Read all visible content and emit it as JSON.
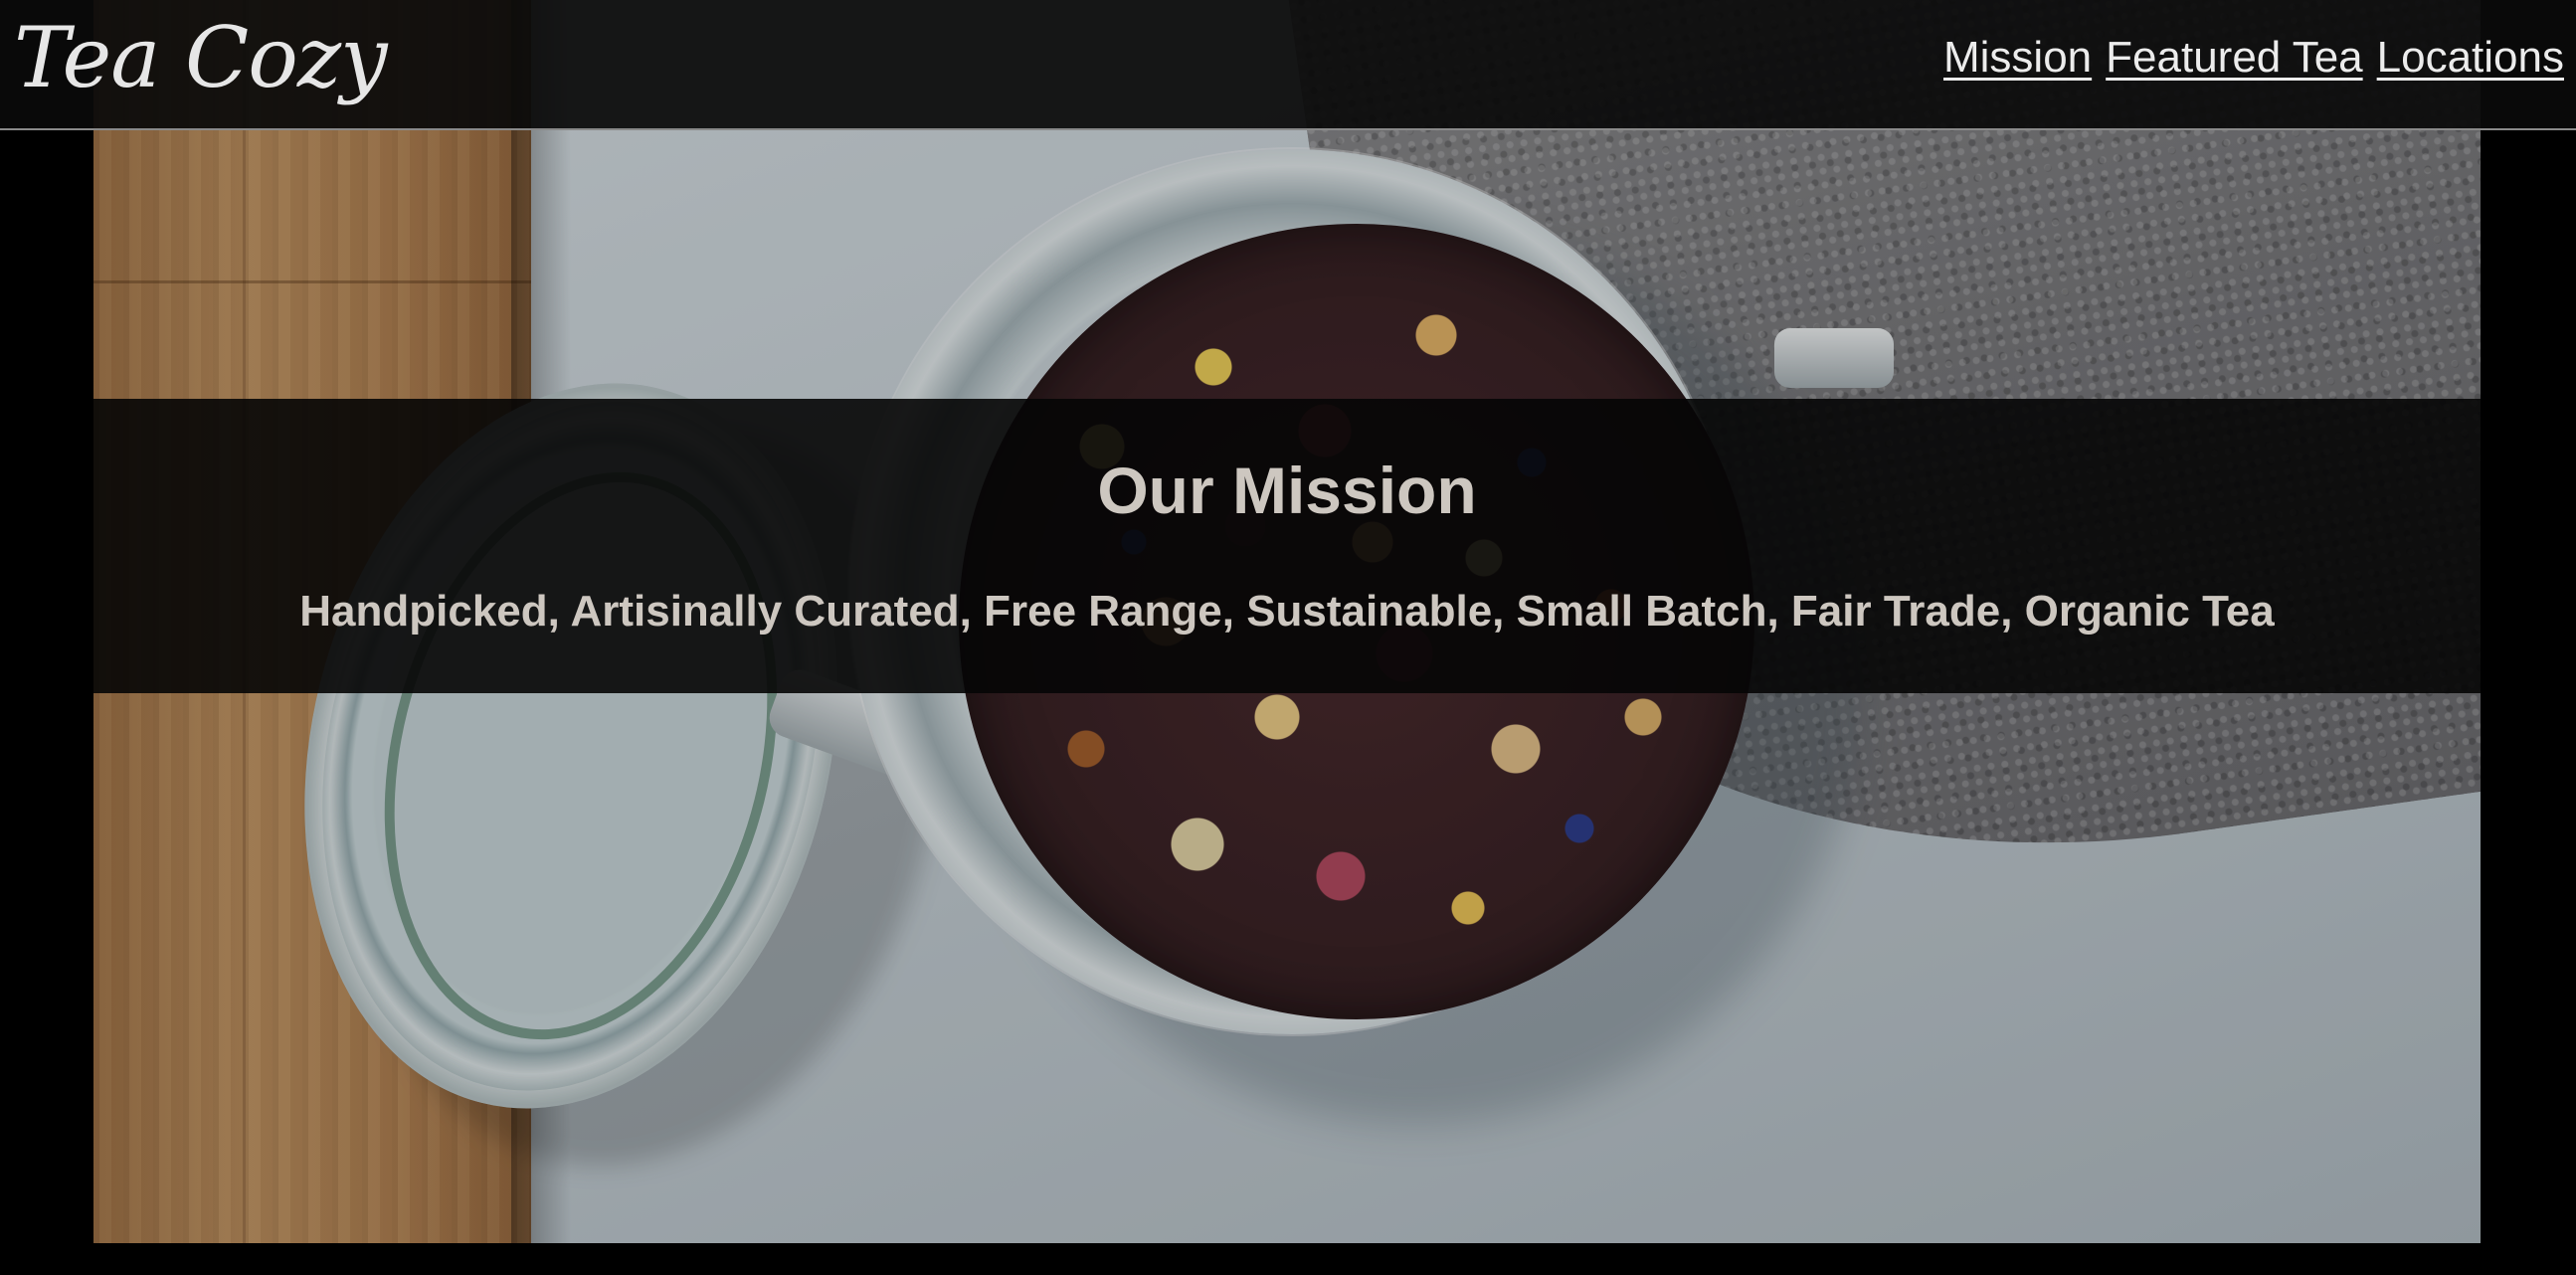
{
  "header": {
    "brand": "Tea Cozy",
    "nav": [
      {
        "label": "Mission"
      },
      {
        "label": "Featured Tea"
      },
      {
        "label": "Locations"
      }
    ]
  },
  "hero": {
    "image_subject": "jar-of-loose-leaf-tea",
    "heading": "Our Mission",
    "tagline": "Handpicked, Artisinally Curated, Free Range, Sustainable, Small Batch, Fair Trade, Organic Tea"
  },
  "colors": {
    "page_background": "#000000",
    "header_background": "#0a0a0a",
    "header_border": "#8a8a8a",
    "nav_text": "#ececec",
    "mission_text": "#cdc7c0"
  }
}
